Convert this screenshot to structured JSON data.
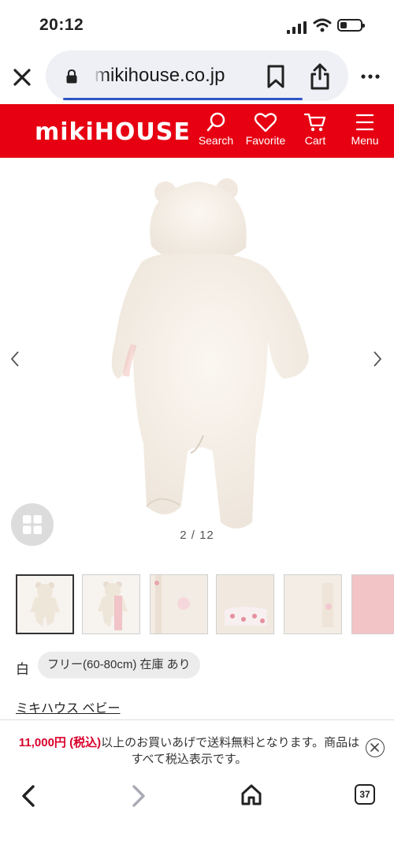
{
  "status_bar": {
    "time": "20:12"
  },
  "browser": {
    "url": "mikihouse.co.jp",
    "open_tabs": "37"
  },
  "site_header": {
    "logo": "mikiHOUSE",
    "search_label": "Search",
    "favorite_label": "Favorite",
    "cart_label": "Cart",
    "menu_label": "Menu"
  },
  "gallery": {
    "counter": "2 / 12",
    "current_index": 2,
    "total": 12
  },
  "product": {
    "color": "白",
    "size_stock": "フリー(60-80cm) 在庫 あり",
    "brand": "ミキハウス ベビー"
  },
  "banner": {
    "price": "11,000円 (税込)",
    "message": "以上のお買いあげで送料無料となります。商品はすべて税込表示です。"
  },
  "colors": {
    "brand_red": "#e60012",
    "progress_blue": "#2f55c8",
    "price_red": "#d9002b"
  }
}
